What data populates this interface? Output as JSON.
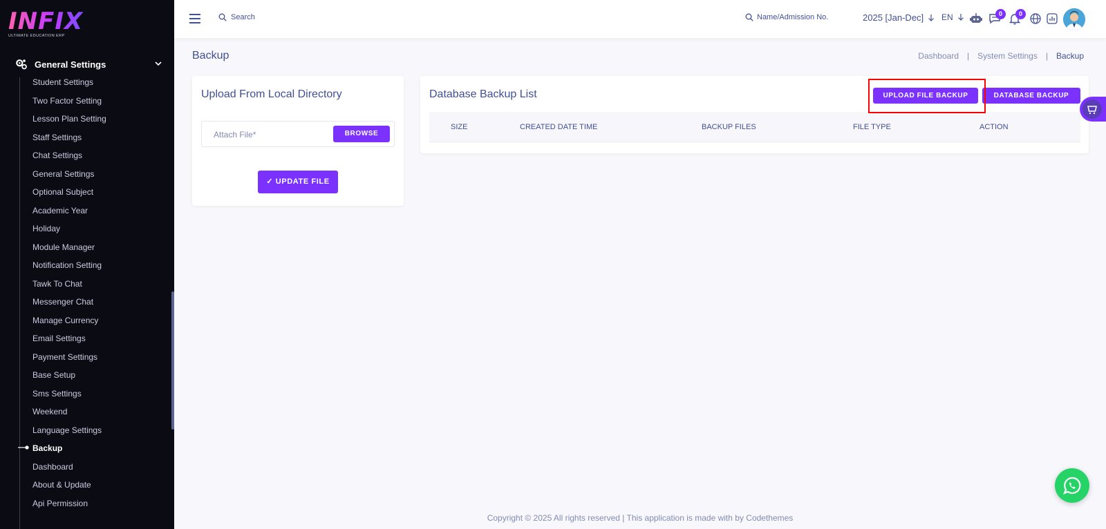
{
  "brand": {
    "name": "INFIX",
    "tagline": "ULTIMATE EDUCATION ERP"
  },
  "sidebar": {
    "section": "General Settings",
    "items": [
      "Student Settings",
      "Two Factor Setting",
      "Lesson Plan Setting",
      "Staff Settings",
      "Chat Settings",
      "General Settings",
      "Optional Subject",
      "Academic Year",
      "Holiday",
      "Module Manager",
      "Notification Setting",
      "Tawk To Chat",
      "Messenger Chat",
      "Manage Currency",
      "Email Settings",
      "Payment Settings",
      "Base Setup",
      "Sms Settings",
      "Weekend",
      "Language Settings",
      "Backup",
      "Dashboard",
      "About & Update",
      "Api Permission"
    ],
    "active": "Backup"
  },
  "header": {
    "search_label": "Search",
    "student_search_label": "Name/Admission No.",
    "year": "2025 [Jan-Dec]",
    "lang": "EN",
    "chat_count": "0",
    "notify_count": "0"
  },
  "page": {
    "title": "Backup",
    "breadcrumb": [
      "Dashboard",
      "System Settings",
      "Backup"
    ]
  },
  "upload_card": {
    "title": "Upload From Local Directory",
    "file_placeholder": "Attach File*",
    "browse": "BROWSE",
    "update": "✓ UPDATE FILE"
  },
  "list_card": {
    "title": "Database Backup List",
    "upload_btn": "UPLOAD FILE BACKUP",
    "db_btn": "DATABASE BACKUP",
    "columns": [
      "SIZE",
      "CREATED DATE TIME",
      "BACKUP FILES",
      "FILE TYPE",
      "ACTION"
    ]
  },
  "footer": "Copyright © 2025 All rights reserved | This application is made with by Codethemes",
  "colors": {
    "accent": "#7c32ff",
    "sidebar_bg": "#0b0b14",
    "text": "#415094",
    "highlight": "#ff0000"
  }
}
